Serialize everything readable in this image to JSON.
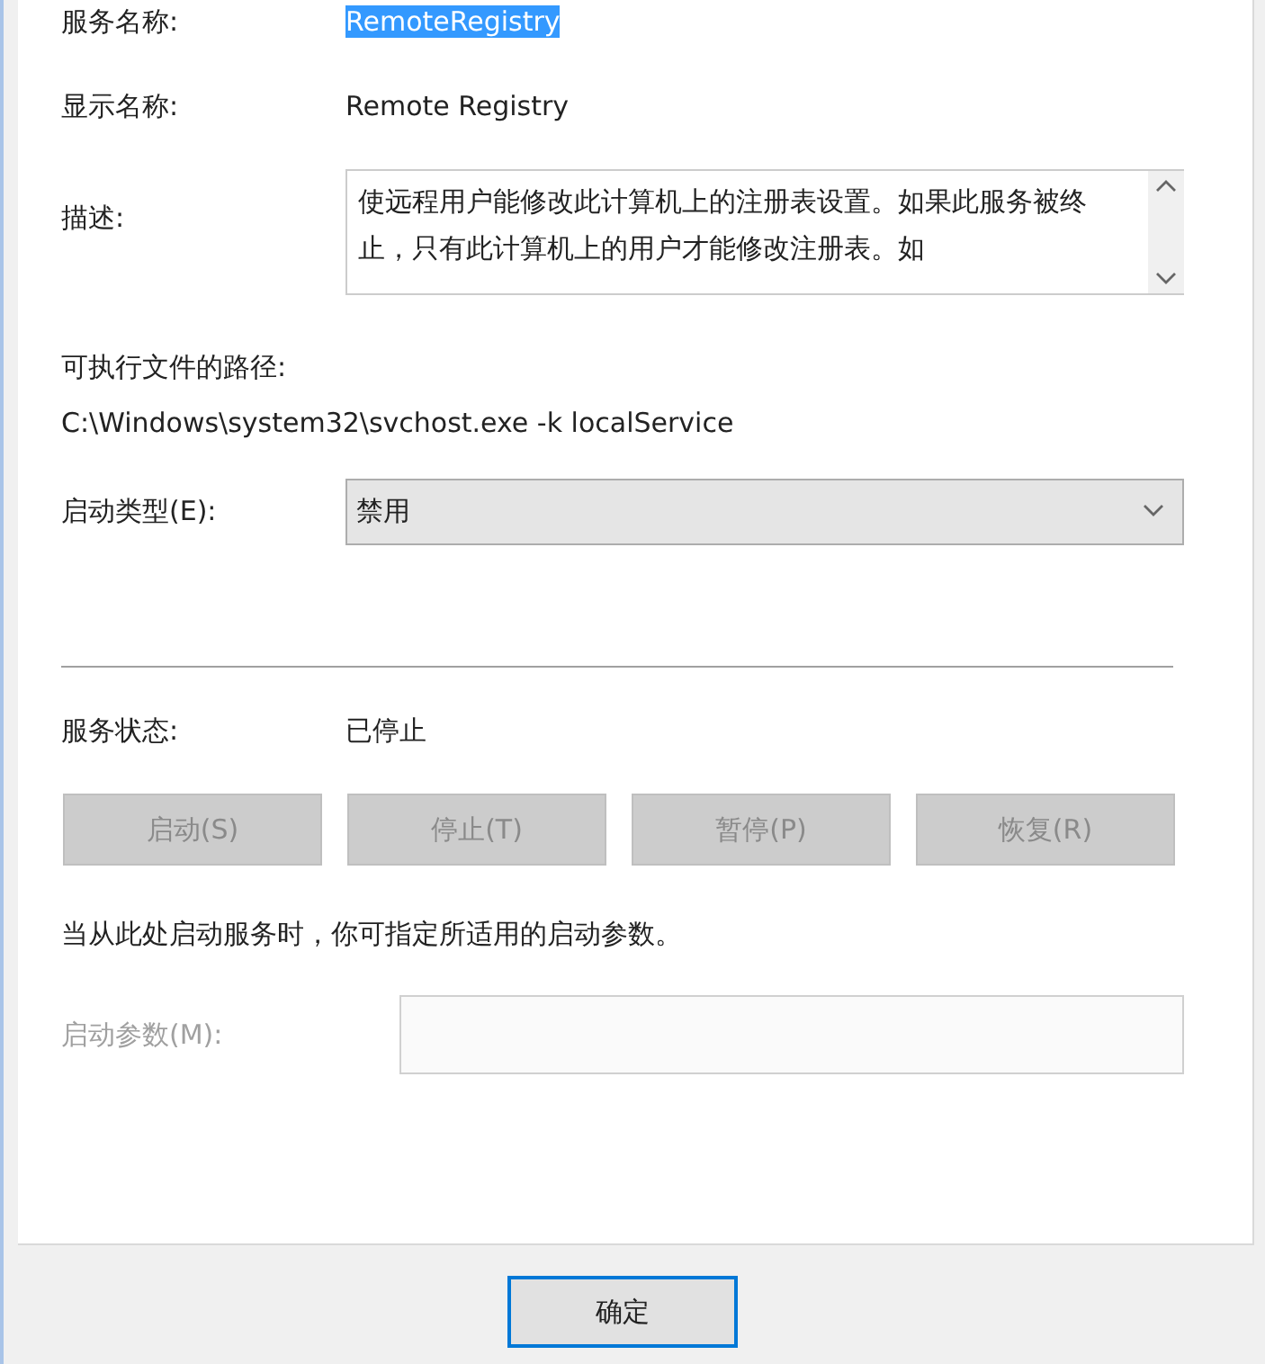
{
  "fields": [
    {
      "kind": "selected_text",
      "label": "服务名称:",
      "value": "RemoteRegistry"
    },
    {
      "kind": "text",
      "label": "显示名称:",
      "value": "Remote Registry"
    },
    {
      "kind": "textarea",
      "label": "描述:",
      "value": "使远程用户能修改此计算机上的注册表设置。如果此服务被终止，只有此计算机上的用户才能修改注册表。如"
    }
  ],
  "path": {
    "label": "可执行文件的路径:",
    "value": "C:\\Windows\\system32\\svchost.exe -k localService"
  },
  "startup_type": {
    "label": "启动类型(E):",
    "value": "禁用"
  },
  "status": {
    "label": "服务状态:",
    "value": "已停止"
  },
  "service_buttons": [
    {
      "label": "启动(S)",
      "disabled": true
    },
    {
      "label": "停止(T)",
      "disabled": true
    },
    {
      "label": "暂停(P)",
      "disabled": true
    },
    {
      "label": "恢复(R)",
      "disabled": true
    }
  ],
  "hint": "当从此处启动服务时，你可指定所适用的启动参数。",
  "parameters": {
    "label": "启动参数(M):",
    "disabled": true
  },
  "footer_buttons": [
    {
      "label": "确定",
      "selected": true
    }
  ]
}
